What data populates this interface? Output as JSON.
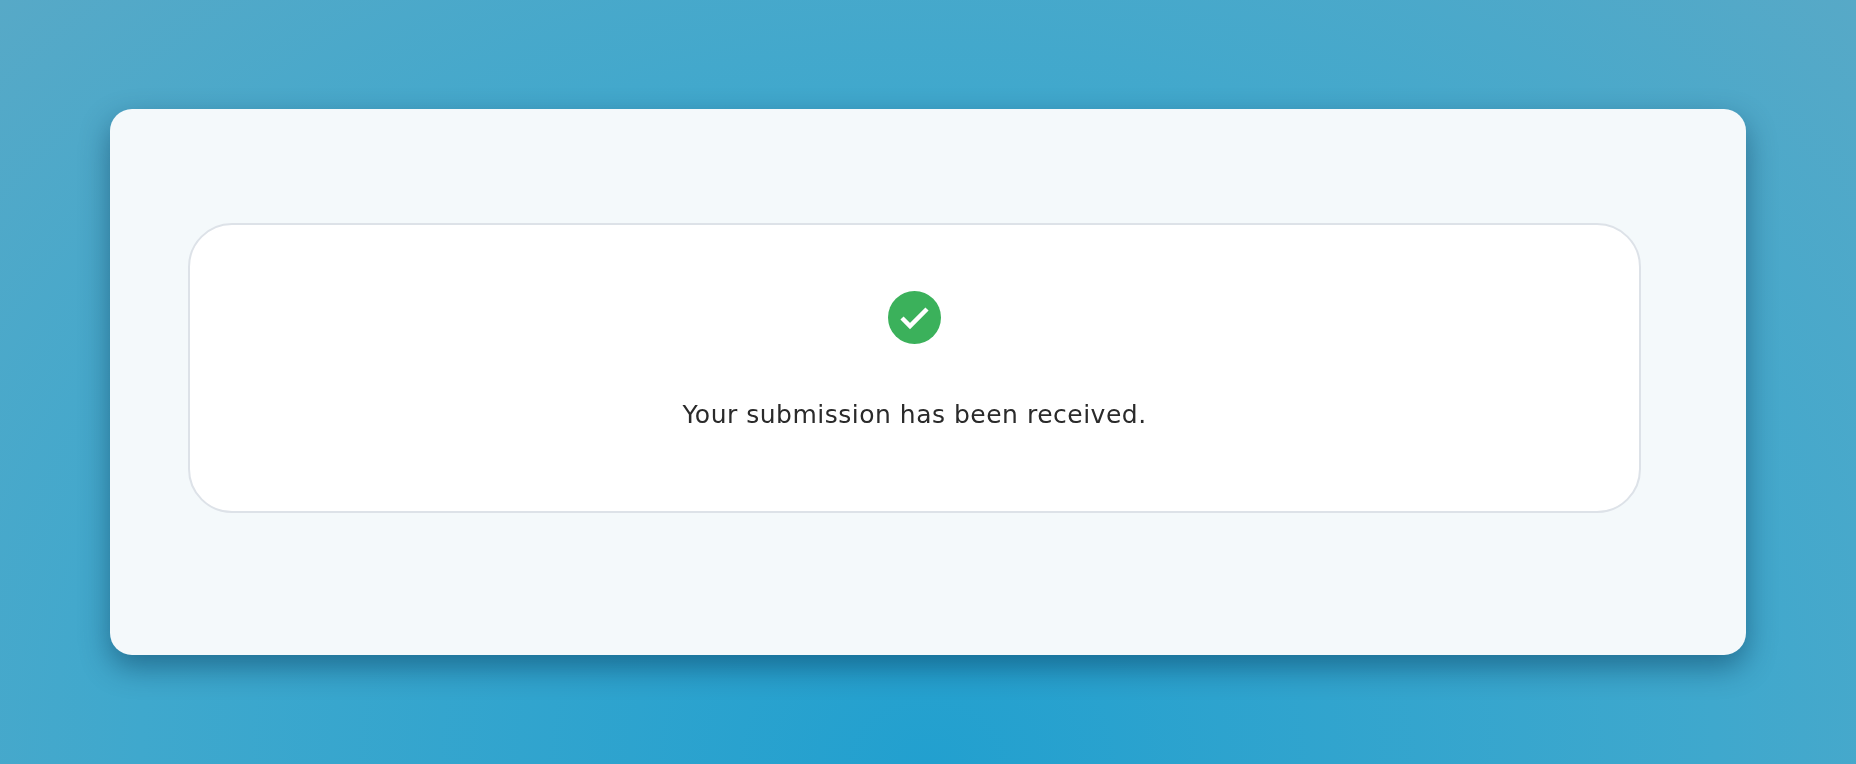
{
  "message": {
    "success": true,
    "text": "Your submission has been received."
  }
}
